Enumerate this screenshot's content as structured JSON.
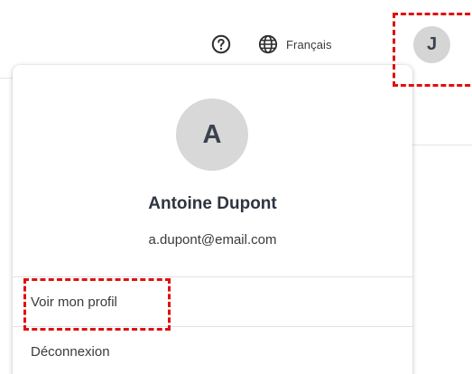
{
  "header": {
    "help_icon": "question-circle-icon",
    "language_icon": "globe-icon",
    "language_label": "Français",
    "avatar_initial": "J"
  },
  "profile_menu": {
    "avatar_initial": "A",
    "name": "Antoine Dupont",
    "email": "a.dupont@email.com",
    "items": [
      {
        "label": "Voir mon profil"
      },
      {
        "label": "Déconnexion"
      }
    ]
  },
  "colors": {
    "avatar_bg": "#d5d5d5",
    "avatar_text": "#3a4250",
    "highlight": "#e01010"
  }
}
